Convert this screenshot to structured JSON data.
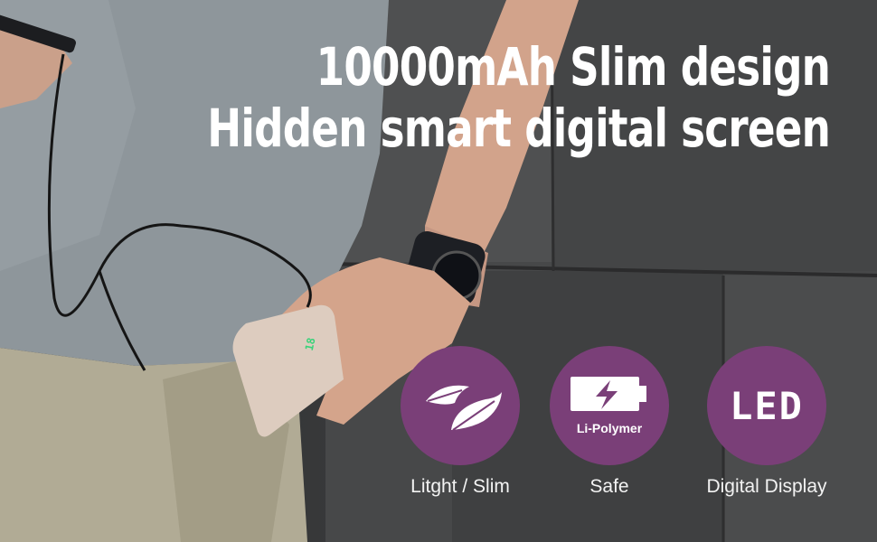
{
  "headline": {
    "line1": "10000mAh Slim design",
    "line2": "Hidden smart digital screen"
  },
  "device_display_value": "18",
  "features": [
    {
      "icon": "feather-icon",
      "label": "Litght / Slim"
    },
    {
      "icon": "battery-bolt-icon",
      "badge_text": "Li-Polymer",
      "label": "Safe"
    },
    {
      "icon": "led-icon",
      "badge_text": "LED",
      "label": "Digital Display"
    }
  ],
  "colors": {
    "badge": "#7a3f78",
    "text": "#ffffff",
    "device_display": "#39d27a"
  }
}
